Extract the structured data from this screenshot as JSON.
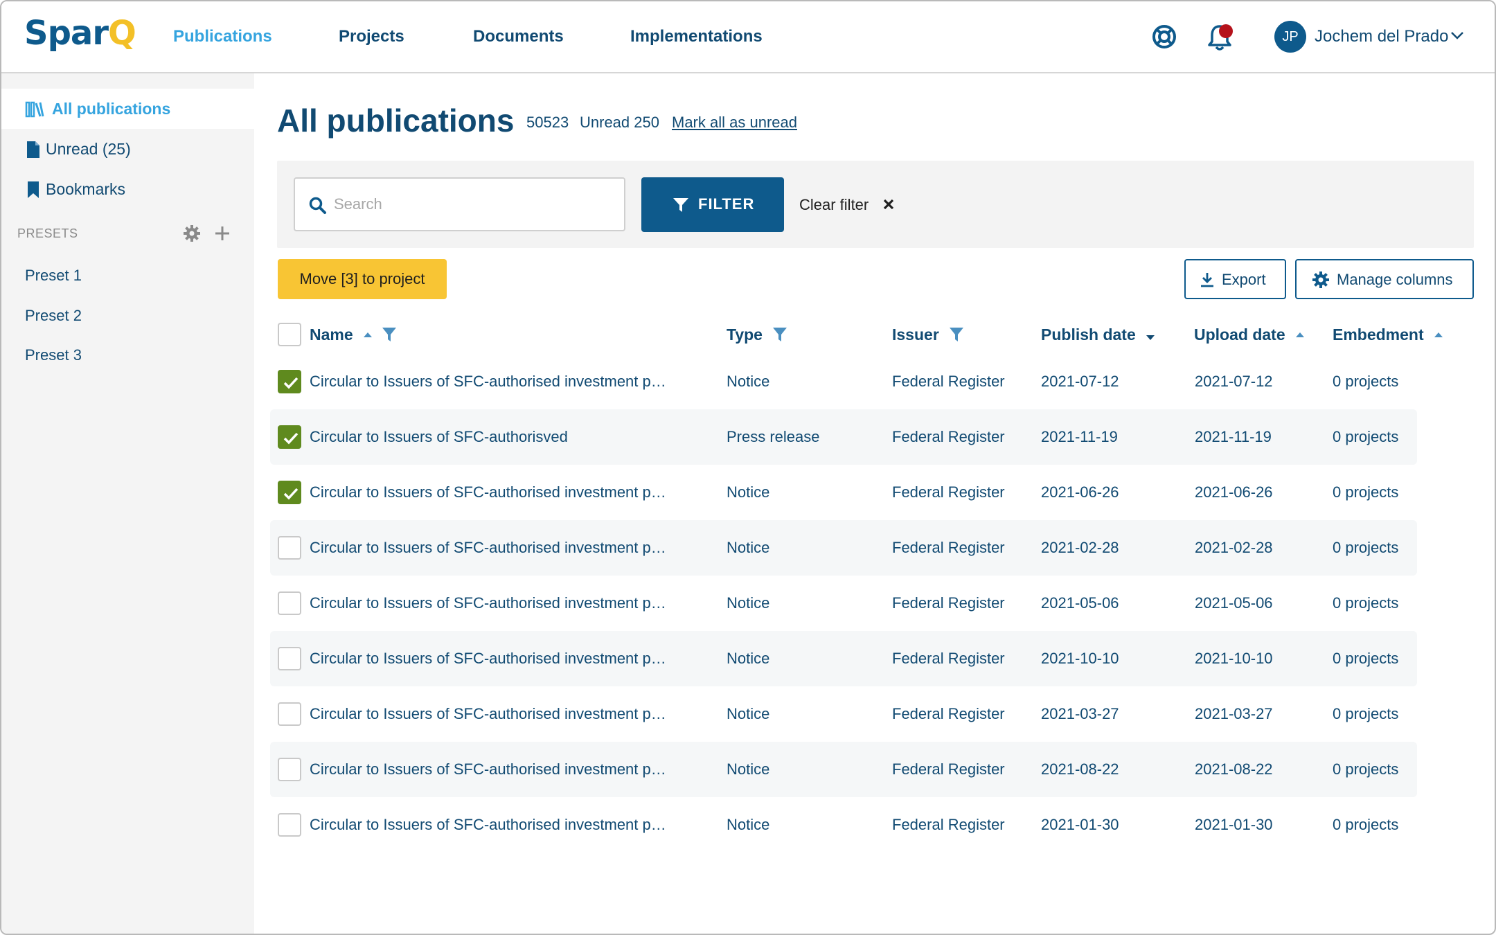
{
  "app": {
    "logo_part1": "Spar",
    "logo_part2": "Q",
    "brand_color": "#0e5a8c",
    "accent_color": "#f3c027"
  },
  "nav": {
    "items": [
      {
        "label": "Publications",
        "active": true
      },
      {
        "label": "Projects",
        "active": false
      },
      {
        "label": "Documents",
        "active": false
      },
      {
        "label": "Implementations",
        "active": false
      }
    ]
  },
  "header": {
    "support_icon": "lifebuoy-icon",
    "notification_icon": "bell-icon",
    "notification_dot_color": "#b5121b",
    "user_initials": "JP",
    "user_name": "Jochem del Prado"
  },
  "sidebar": {
    "items": [
      {
        "label": "All publications",
        "icon": "library-icon",
        "active": true
      },
      {
        "label": "Unread (25)",
        "icon": "document-icon",
        "active": false
      },
      {
        "label": "Bookmarks",
        "icon": "bookmark-icon",
        "active": false
      }
    ],
    "presets_title": "PRESETS",
    "presets": [
      "Preset 1",
      "Preset 2",
      "Preset 3"
    ]
  },
  "main": {
    "title": "All publications",
    "total_count": "50523",
    "unread_label": "Unread 250",
    "mark_all_label": "Mark all as unread"
  },
  "filters": {
    "search_placeholder": "Search",
    "search_value": "",
    "filter_label": "FILTER",
    "clear_label": "Clear filter"
  },
  "actions": {
    "move_label": "Move [3] to project",
    "export_label": "Export",
    "manage_columns_label": "Manage columns"
  },
  "table": {
    "columns": [
      {
        "label": "Name",
        "sort": "asc",
        "filter": true
      },
      {
        "label": "Type",
        "sort": null,
        "filter": true
      },
      {
        "label": "Issuer",
        "sort": null,
        "filter": true
      },
      {
        "label": "Publish date",
        "sort": "desc",
        "filter": false
      },
      {
        "label": "Upload date",
        "sort": "asc",
        "filter": false
      },
      {
        "label": "Embedment",
        "sort": "asc",
        "filter": false
      }
    ],
    "rows": [
      {
        "checked": true,
        "name": "Circular to Issuers of SFC-authorised investment products",
        "type": "Notice",
        "issuer": "Federal Register",
        "publish": "2021-07-12",
        "upload": "2021-07-12",
        "embedment": "0 projects"
      },
      {
        "checked": true,
        "name": "Circular to Issuers of SFC-authorisved",
        "type": "Press release",
        "issuer": "Federal Register",
        "publish": "2021-11-19",
        "upload": "2021-11-19",
        "embedment": "0 projects"
      },
      {
        "checked": true,
        "name": "Circular to Issuers of SFC-authorised investment products",
        "type": "Notice",
        "issuer": "Federal Register",
        "publish": "2021-06-26",
        "upload": "2021-06-26",
        "embedment": "0 projects"
      },
      {
        "checked": false,
        "name": "Circular to Issuers of SFC-authorised investment products",
        "type": "Notice",
        "issuer": "Federal Register",
        "publish": "2021-02-28",
        "upload": "2021-02-28",
        "embedment": "0 projects"
      },
      {
        "checked": false,
        "name": "Circular to Issuers of SFC-authorised investment products",
        "type": "Notice",
        "issuer": "Federal Register",
        "publish": "2021-05-06",
        "upload": "2021-05-06",
        "embedment": "0 projects"
      },
      {
        "checked": false,
        "name": "Circular to Issuers of SFC-authorised investment products",
        "type": "Notice",
        "issuer": "Federal Register",
        "publish": "2021-10-10",
        "upload": "2021-10-10",
        "embedment": "0 projects"
      },
      {
        "checked": false,
        "name": "Circular to Issuers of SFC-authorised investment products",
        "type": "Notice",
        "issuer": "Federal Register",
        "publish": "2021-03-27",
        "upload": "2021-03-27",
        "embedment": "0 projects"
      },
      {
        "checked": false,
        "name": "Circular to Issuers of SFC-authorised investment products",
        "type": "Notice",
        "issuer": "Federal Register",
        "publish": "2021-08-22",
        "upload": "2021-08-22",
        "embedment": "0 projects"
      },
      {
        "checked": false,
        "name": "Circular to Issuers of SFC-authorised investment products",
        "type": "Notice",
        "issuer": "Federal Register",
        "publish": "2021-01-30",
        "upload": "2021-01-30",
        "embedment": "0 projects"
      }
    ]
  }
}
